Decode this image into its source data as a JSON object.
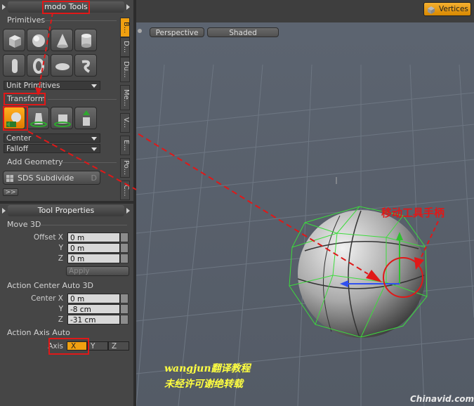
{
  "left_panel": {
    "header_title": "modo Tools",
    "primitives_label": "Primitives",
    "unit_primitives_value": "Unit Primitives",
    "transform_label": "Transform",
    "center_value": "Center",
    "falloff_value": "Falloff",
    "add_geometry_label": "Add Geometry",
    "sds_subdivide_label": "SDS Subdivide",
    "sds_shortcut": "D",
    "more_label": ">>",
    "tabs": [
      "B...",
      "D...",
      "Du...",
      "Me...",
      "V...",
      "E...",
      "Po...",
      "C..."
    ]
  },
  "tool_properties": {
    "header_title": "Tool Properties",
    "move3d_label": "Move 3D",
    "offset_x_label": "Offset X",
    "offset_y_label": "Y",
    "offset_z_label": "Z",
    "offset_x": "0 m",
    "offset_y": "0 m",
    "offset_z": "0 m",
    "apply_label": "Apply",
    "action_center_label": "Action Center Auto 3D",
    "center_x_label": "Center X",
    "center_y_label": "Y",
    "center_z_label": "Z",
    "center_x": "0 m",
    "center_y": "-8 cm",
    "center_z": "-31 cm",
    "action_axis_label": "Action Axis Auto",
    "axis_label": "Axis",
    "axis_options": [
      "X",
      "Y",
      "Z"
    ],
    "axis_selected": "X"
  },
  "top_bar": {
    "vertices_label": "Vertices"
  },
  "viewport": {
    "perspective_label": "Perspective",
    "shaded_label": "Shaded"
  },
  "annotations": {
    "handle_label": "移动工具手柄",
    "credit_line1": "wangjun翻译教程",
    "credit_line2": "未经许可谢绝转载",
    "watermark": "Chinavid.com"
  },
  "colors": {
    "accent_orange": "#f0a010",
    "annotation_red": "#e01818",
    "wireframe_green": "#3cdc3c",
    "credit_yellow": "#ffff40"
  }
}
